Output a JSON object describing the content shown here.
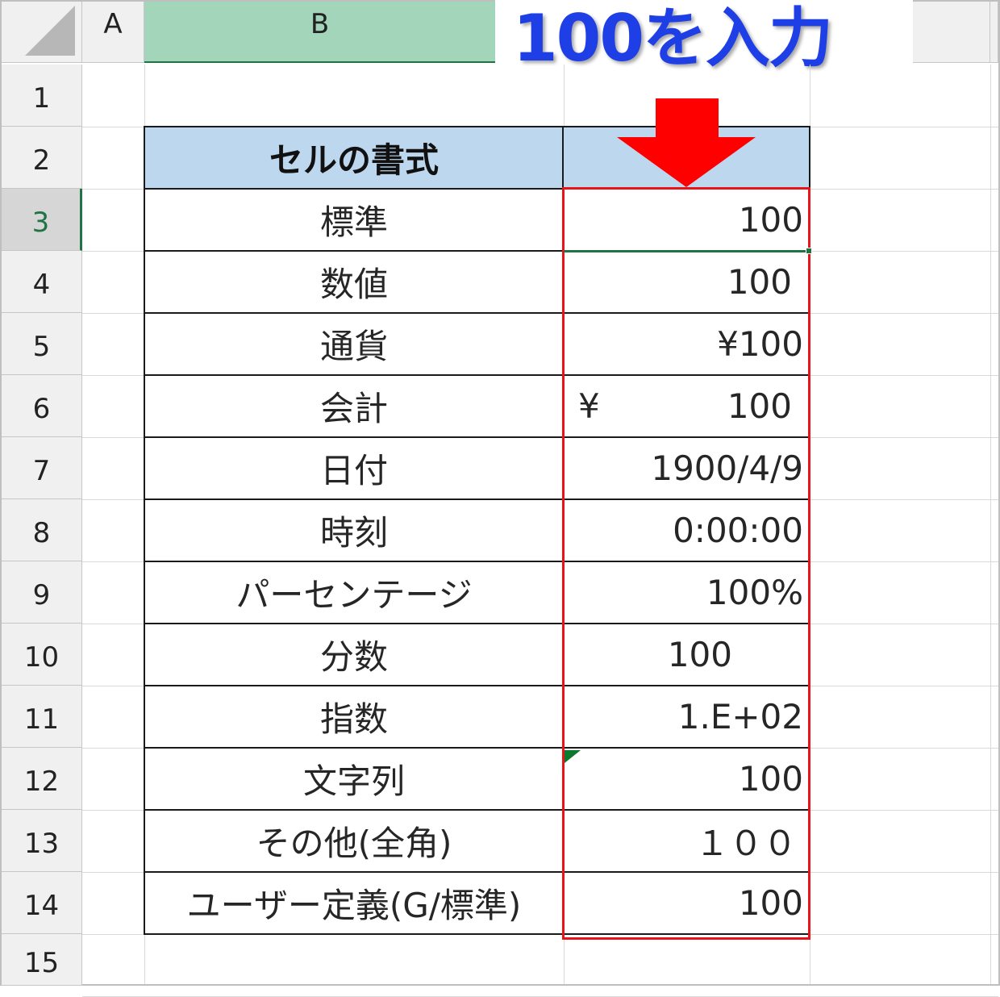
{
  "banner": {
    "text": "100を入力"
  },
  "columns": [
    "A",
    "B"
  ],
  "rows": [
    "1",
    "2",
    "3",
    "4",
    "5",
    "6",
    "7",
    "8",
    "9",
    "10",
    "11",
    "12",
    "13",
    "14",
    "15"
  ],
  "table": {
    "header": {
      "label": "セルの書式",
      "value": ""
    },
    "rows": [
      {
        "label": "標準",
        "value": "100"
      },
      {
        "label": "数値",
        "value": "100"
      },
      {
        "label": "通貨",
        "value": "¥100"
      },
      {
        "label": "会計",
        "currency": "¥",
        "value": "100"
      },
      {
        "label": "日付",
        "value": "1900/4/9"
      },
      {
        "label": "時刻",
        "value": "0:00:00"
      },
      {
        "label": "パーセンテージ",
        "value": "100%"
      },
      {
        "label": "分数",
        "value": "100"
      },
      {
        "label": "指数",
        "value": "1.E+02"
      },
      {
        "label": "文字列",
        "value": "100"
      },
      {
        "label": "その他(全角)",
        "value": "１００"
      },
      {
        "label": "ユーザー定義(G/標準)",
        "value": "100"
      }
    ]
  },
  "colors": {
    "header_fill": "#bdd7ee",
    "highlight_border": "#e8141a",
    "arrow": "#ff0000",
    "banner_text": "#1f3fe6",
    "selection": "#217346"
  },
  "selected_cell": {
    "row": "3",
    "column": "C"
  }
}
